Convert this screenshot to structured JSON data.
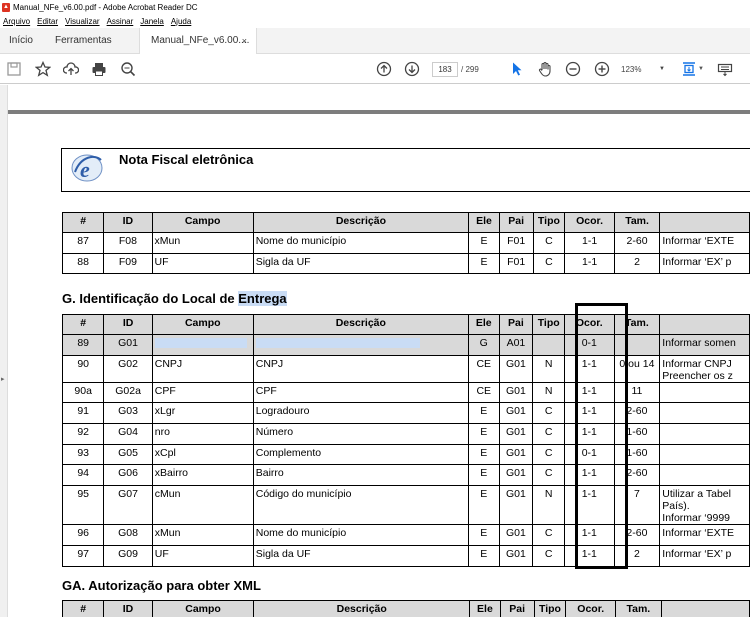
{
  "window": {
    "title": "Manual_NFe_v6.00.pdf - Adobe Acrobat Reader DC"
  },
  "menu": {
    "items": [
      "Arquivo",
      "Editar",
      "Visualizar",
      "Assinar",
      "Janela",
      "Ajuda"
    ]
  },
  "tabs": {
    "inicio": "Início",
    "ferramentas": "Ferramentas",
    "document": "Manual_NFe_v6.00....",
    "close": "×"
  },
  "toolbar": {
    "page_current": "183",
    "page_total": "/ 299",
    "zoom": "123%",
    "zoom_arrow": "▼"
  },
  "header": {
    "title": "Nota Fiscal eletrônica",
    "logo_letter": "e"
  },
  "columns": [
    "#",
    "ID",
    "Campo",
    "Descrição",
    "Ele",
    "Pai",
    "Tipo",
    "Ocor.",
    "Tam.",
    ""
  ],
  "table1": {
    "rows": [
      [
        "87",
        "F08",
        "xMun",
        "Nome do município",
        "E",
        "F01",
        "C",
        "1-1",
        "2-60",
        "Informar ‘EXTE"
      ],
      [
        "88",
        "F09",
        "UF",
        "Sigla da UF",
        "E",
        "F01",
        "C",
        "1-1",
        "2",
        "Informar ‘EX’ p"
      ]
    ]
  },
  "section_g": {
    "title_pre": "G. Identificação do Local de ",
    "title_hl": "Entrega"
  },
  "table2": {
    "rows": [
      [
        "89",
        "G01",
        "",
        "",
        "G",
        "A01",
        "",
        "0-1",
        "",
        "Informar somen"
      ],
      [
        "90",
        "G02",
        "CNPJ",
        "CNPJ",
        "CE",
        "G01",
        "N",
        "1-1",
        "0 ou 14",
        "Informar CNPJ\nPreencher os z"
      ],
      [
        "90a",
        "G02a",
        "CPF",
        "CPF",
        "CE",
        "G01",
        "N",
        "1-1",
        "11",
        ""
      ],
      [
        "91",
        "G03",
        "xLgr",
        "Logradouro",
        "E",
        "G01",
        "C",
        "1-1",
        "2-60",
        ""
      ],
      [
        "92",
        "G04",
        "nro",
        "Número",
        "E",
        "G01",
        "C",
        "1-1",
        "1-60",
        ""
      ],
      [
        "93",
        "G05",
        "xCpl",
        "Complemento",
        "E",
        "G01",
        "C",
        "0-1",
        "1-60",
        ""
      ],
      [
        "94",
        "G06",
        "xBairro",
        "Bairro",
        "E",
        "G01",
        "C",
        "1-1",
        "2-60",
        ""
      ],
      [
        "95",
        "G07",
        "cMun",
        "Código do município",
        "E",
        "G01",
        "N",
        "1-1",
        "7",
        "Utilizar a Tabel\nPaís).\nInformar ‘9999"
      ],
      [
        "96",
        "G08",
        "xMun",
        "Nome do município",
        "E",
        "G01",
        "C",
        "1-1",
        "2-60",
        "Informar ‘EXTE"
      ],
      [
        "97",
        "G09",
        "UF",
        "Sigla da UF",
        "E",
        "G01",
        "C",
        "1-1",
        "2",
        "Informar ‘EX’ p"
      ]
    ]
  },
  "section_ga": {
    "title": "GA. Autorização para obter XML"
  }
}
